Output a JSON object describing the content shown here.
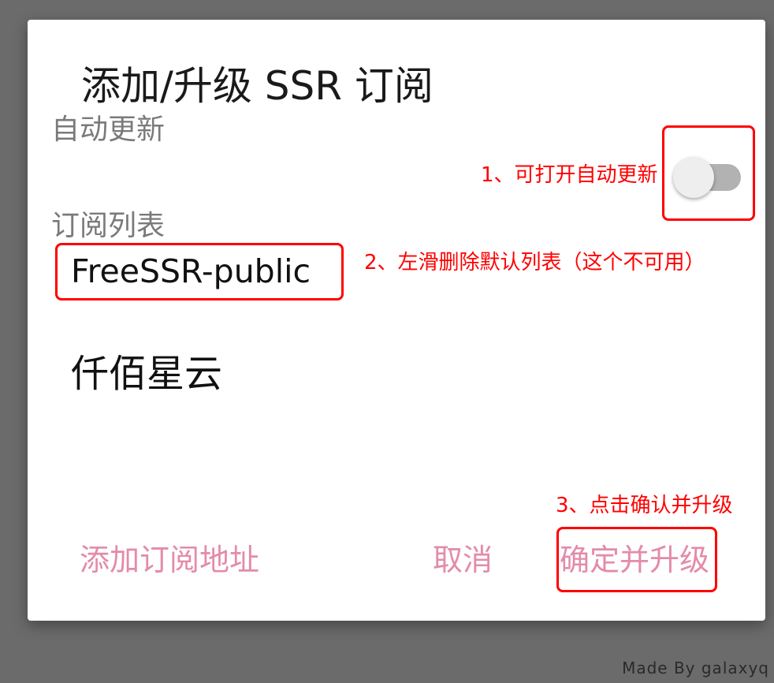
{
  "dialog": {
    "title": "添加/升级 SSR 订阅",
    "auto_update_label": "自动更新",
    "auto_update_on": false,
    "list_label": "订阅列表",
    "items": [
      {
        "name": "FreeSSR-public"
      },
      {
        "name": "仟佰星云"
      }
    ],
    "actions": {
      "add": "添加订阅地址",
      "cancel": "取消",
      "confirm": "确定并升级"
    }
  },
  "annotations": {
    "step1": "1、可打开自动更新",
    "step2": "2、左滑删除默认列表（这个不可用）",
    "step3": "3、点击确认并升级"
  },
  "watermark": "Made By galaxyq",
  "colors": {
    "overlay": "#6b6b6b",
    "dialog_bg": "#ffffff",
    "action_text": "#e38bab",
    "annotation": "#ff0000",
    "switch_track_off": "#b2b2b2",
    "switch_thumb": "#eeeeee"
  }
}
